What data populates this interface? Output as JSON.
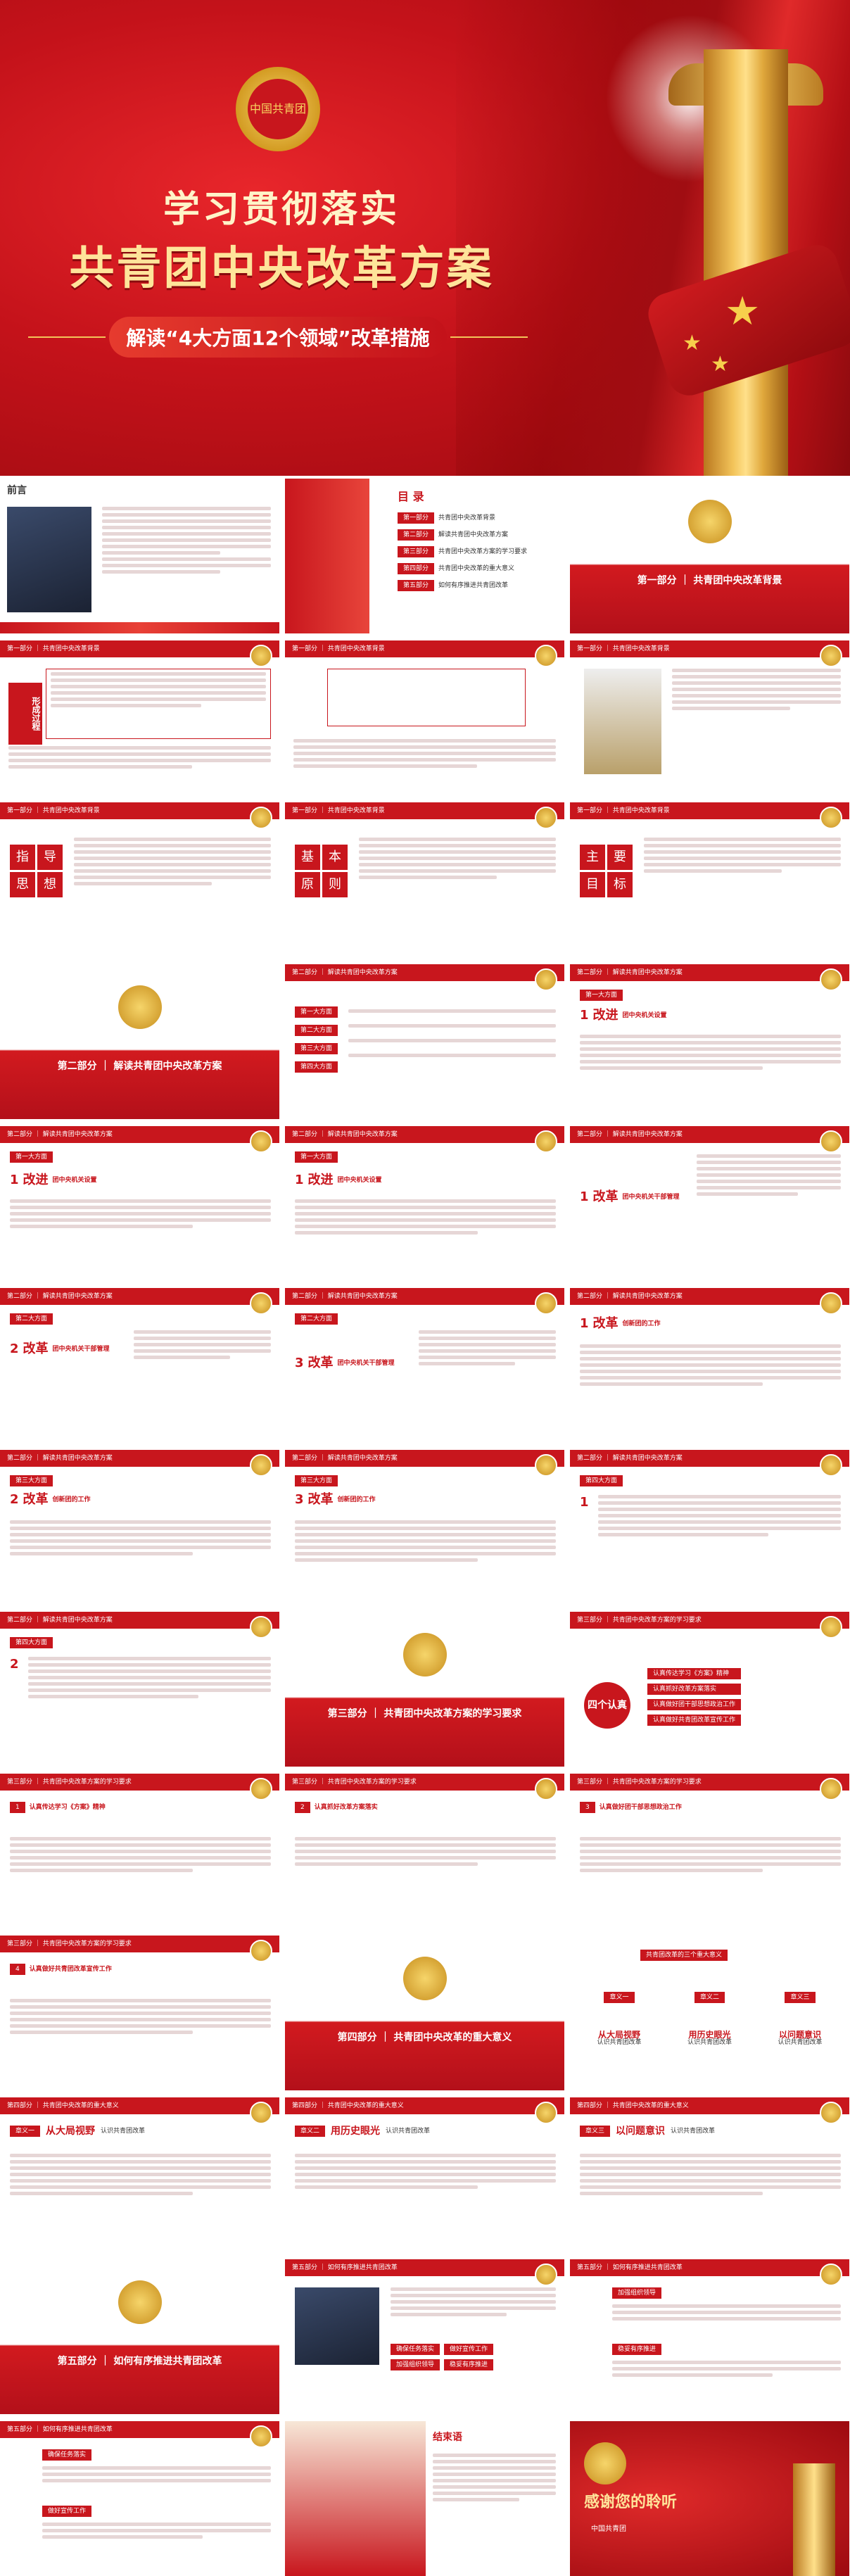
{
  "cover": {
    "badge_text": "中国共青团",
    "title1": "学习贯彻落实",
    "title2": "共青团中央改革方案",
    "subtitle": "解读“4大方面12个领域”改革措施",
    "colors": {
      "primary": "#c8161d",
      "gold": "#f3c45a"
    }
  },
  "slides": {
    "preface": {
      "title": "前言"
    },
    "toc": {
      "title": "目 录",
      "items": [
        {
          "num": "第一部分",
          "text": "共青团中央改革背景"
        },
        {
          "num": "第二部分",
          "text": "解读共青团中央改革方案"
        },
        {
          "num": "第三部分",
          "text": "共青团中央改革方案的学习要求"
        },
        {
          "num": "第四部分",
          "text": "共青团中央改革的重大意义"
        },
        {
          "num": "第五部分",
          "text": "如何有序推进共青团改革"
        }
      ]
    },
    "part1": "第一部分 ｜ 共青团中央改革背景",
    "part2": "第二部分 ｜ 解读共青团中央改革方案",
    "part3": "第三部分 ｜ 共青团中央改革方案的学习要求",
    "part4": "第四部分 ｜ 共青团中央改革的重大意义",
    "part5": "第五部分 ｜ 如何有序推进共青团改革",
    "bg_bar": "第一部分 ｜ 共青团中央改革背景",
    "reform_bar": "第二部分 ｜ 解读共青团中央改革方案",
    "study_bar": "第三部分 ｜ 共青团中央改革方案的学习要求",
    "meaning_bar": "第四部分 ｜ 共青团中央改革的重大意义",
    "advance_bar": "第五部分 ｜ 如何有序推进共青团改革",
    "xingcheng": "形成过程",
    "zhidao": [
      "指",
      "导",
      "思",
      "想"
    ],
    "jiben": [
      "基",
      "本",
      "原",
      "则"
    ],
    "zhuyao": [
      "主",
      "要",
      "目",
      "标"
    ],
    "four_areas": [
      "第一大方面",
      "第二大方面",
      "第三大方面",
      "第四大方面"
    ],
    "reform_labels": [
      {
        "num": "1",
        "title": "改进",
        "sub": "团中央机关设置"
      },
      {
        "num": "2",
        "title": "改革",
        "sub": "团中央机关干部管理"
      },
      {
        "num": "3",
        "title": "改革",
        "sub": "创新团的工作"
      }
    ],
    "four_req_center": "四个认真",
    "four_req": [
      "认真传达学习《方案》精神",
      "认真抓好改革方案落实",
      "认真做好团干部思想政治工作",
      "认真做好共青团改革宣传工作"
    ],
    "study_items": [
      {
        "num": "1",
        "text": "认真传达学习《方案》精神"
      },
      {
        "num": "2",
        "text": "认真抓好改革方案落实"
      },
      {
        "num": "3",
        "text": "认真做好团干部思想政治工作"
      },
      {
        "num": "4",
        "text": "认真做好共青团改革宣传工作"
      }
    ],
    "meaning_title": "共青团改革的三个重大意义",
    "meanings": [
      {
        "chapter": "章义一",
        "title": "从大局视野",
        "sub": "认识共青团改革"
      },
      {
        "chapter": "章义二",
        "title": "用历史眼光",
        "sub": "认识共青团改革"
      },
      {
        "chapter": "章义三",
        "title": "以问题意识",
        "sub": "认识共青团改革"
      }
    ],
    "advance_items": [
      "确保任务落实",
      "做好宣传工作",
      "加强组织领导",
      "稳妥有序推进"
    ],
    "ending_title": "结束语",
    "thanks": "感谢您的聆听",
    "thanks_sub": "中国共青团"
  }
}
